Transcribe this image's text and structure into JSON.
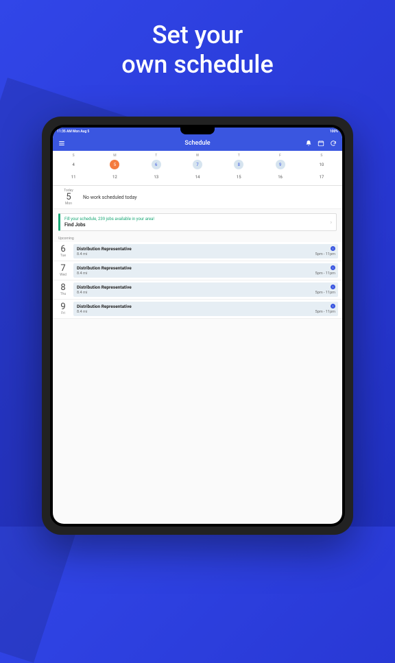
{
  "hero": {
    "line1": "Set your",
    "line2": "own schedule"
  },
  "status": {
    "left": "11:35 AM  Mon Aug 5",
    "right": "100%"
  },
  "topbar": {
    "title": "Schedule"
  },
  "calendar": {
    "dow": [
      "S",
      "M",
      "T",
      "W",
      "T",
      "F",
      "S"
    ],
    "row1": [
      {
        "n": "4",
        "state": "plain"
      },
      {
        "n": "5",
        "state": "selected"
      },
      {
        "n": "6",
        "state": "available"
      },
      {
        "n": "7",
        "state": "available"
      },
      {
        "n": "8",
        "state": "available"
      },
      {
        "n": "9",
        "state": "available"
      },
      {
        "n": "10",
        "state": "plain"
      }
    ],
    "row2": [
      {
        "n": "11"
      },
      {
        "n": "12"
      },
      {
        "n": "13"
      },
      {
        "n": "14"
      },
      {
        "n": "15"
      },
      {
        "n": "16"
      },
      {
        "n": "17"
      }
    ]
  },
  "today": {
    "label": "Today",
    "num": "5",
    "dow": "Mon",
    "message": "No work scheduled today"
  },
  "promo": {
    "line1": "Fill your schedule, 239 jobs available in your area!",
    "line2": "Find Jobs"
  },
  "sections": {
    "upcoming": "Upcoming"
  },
  "jobs": [
    {
      "num": "6",
      "dow": "Tue",
      "title": "Distribution Representative",
      "dist": "8.4 mi",
      "badge": "1",
      "time": "5pm - 11pm"
    },
    {
      "num": "7",
      "dow": "Wed",
      "title": "Distribution Representative",
      "dist": "8.4 mi",
      "badge": "1",
      "time": "5pm - 11pm"
    },
    {
      "num": "8",
      "dow": "Thu",
      "title": "Distribution Representative",
      "dist": "8.4 mi",
      "badge": "1",
      "time": "5pm - 11pm"
    },
    {
      "num": "9",
      "dow": "Fri",
      "title": "Distribution Representative",
      "dist": "8.4 mi",
      "badge": "1",
      "time": "5pm - 11pm"
    }
  ]
}
